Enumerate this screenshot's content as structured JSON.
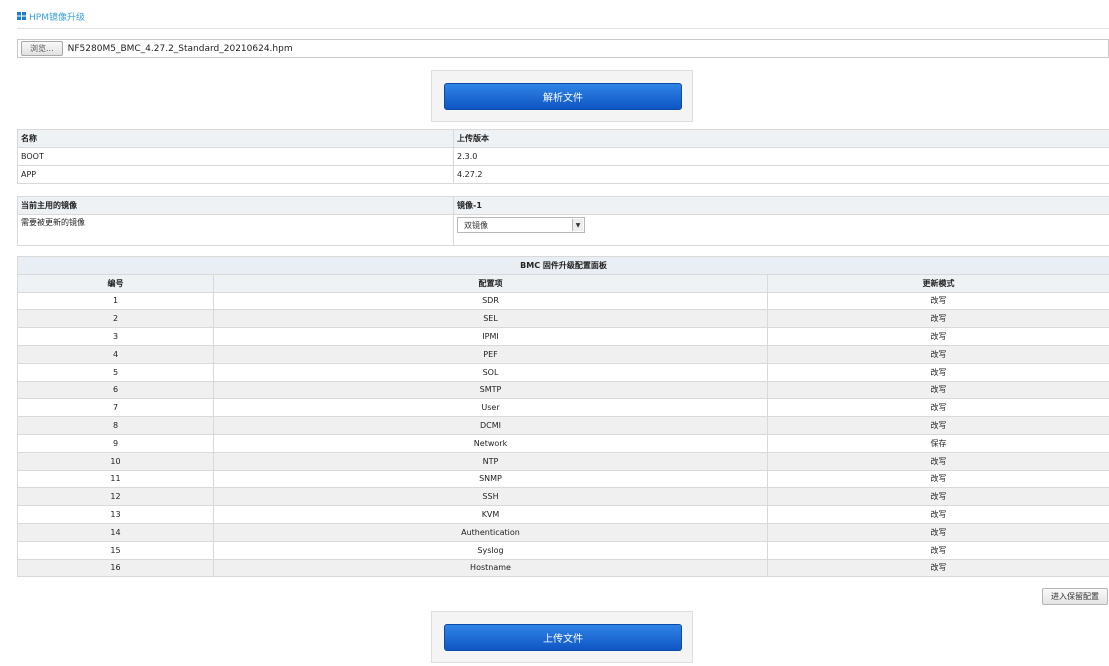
{
  "header": {
    "title": "HPM镜像升级"
  },
  "file": {
    "browse_label": "浏览...",
    "filename": "NF5280M5_BMC_4.27.2_Standard_20210624.hpm"
  },
  "parse_button": "解析文件",
  "version_table": {
    "headers": [
      "名称",
      "上传版本"
    ],
    "rows": [
      [
        "BOOT",
        "2.3.0"
      ],
      [
        "APP",
        "4.27.2"
      ]
    ]
  },
  "image_table": {
    "label_current": "当前主用的镜像",
    "value_current": "镜像-1",
    "label_update": "需要被更新的镜像",
    "select_value": "双镜像"
  },
  "bmc_table": {
    "title": "BMC 固件升级配置面板",
    "headers": [
      "编号",
      "配置项",
      "更新模式"
    ],
    "rows": [
      [
        "1",
        "SDR",
        "改写"
      ],
      [
        "2",
        "SEL",
        "改写"
      ],
      [
        "3",
        "IPMI",
        "改写"
      ],
      [
        "4",
        "PEF",
        "改写"
      ],
      [
        "5",
        "SOL",
        "改写"
      ],
      [
        "6",
        "SMTP",
        "改写"
      ],
      [
        "7",
        "User",
        "改写"
      ],
      [
        "8",
        "DCMI",
        "改写"
      ],
      [
        "9",
        "Network",
        "保存"
      ],
      [
        "10",
        "NTP",
        "改写"
      ],
      [
        "11",
        "SNMP",
        "改写"
      ],
      [
        "12",
        "SSH",
        "改写"
      ],
      [
        "13",
        "KVM",
        "改写"
      ],
      [
        "14",
        "Authentication",
        "改写"
      ],
      [
        "15",
        "Syslog",
        "改写"
      ],
      [
        "16",
        "Hostname",
        "改写"
      ]
    ]
  },
  "reserve_button": "进入保留配置",
  "upload_button": "上传文件"
}
